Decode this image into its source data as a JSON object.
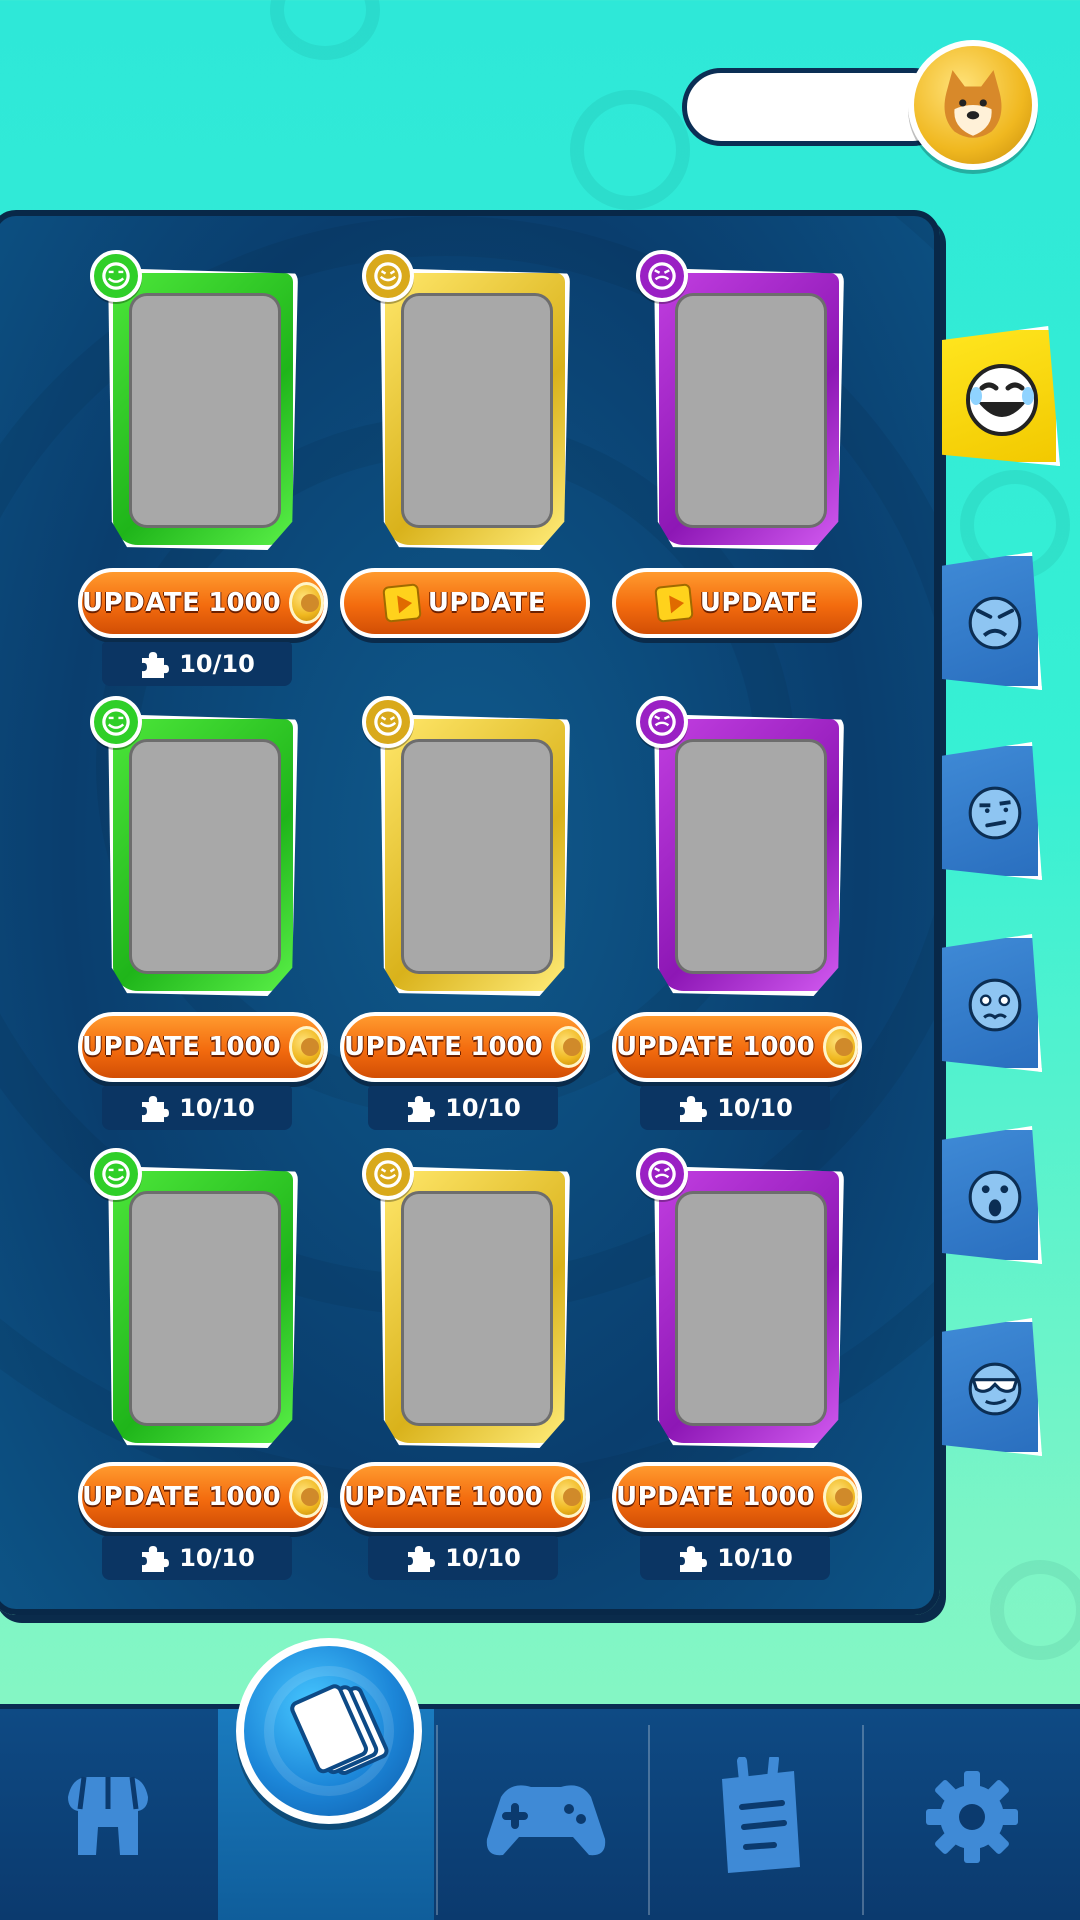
{
  "header": {
    "coin_balance": "",
    "coin_icon": "doge-coin-icon"
  },
  "cards": [
    {
      "color": "green",
      "button": {
        "type": "coin",
        "label": "UPDATE",
        "cost": "1000"
      },
      "progress": "10/10"
    },
    {
      "color": "yellow",
      "button": {
        "type": "video",
        "label": "UPDATE",
        "cost": ""
      },
      "progress": ""
    },
    {
      "color": "purple",
      "button": {
        "type": "video",
        "label": "UPDATE",
        "cost": ""
      },
      "progress": ""
    },
    {
      "color": "green",
      "button": {
        "type": "coin",
        "label": "UPDATE",
        "cost": "1000"
      },
      "progress": "10/10"
    },
    {
      "color": "yellow",
      "button": {
        "type": "coin",
        "label": "UPDATE",
        "cost": "1000"
      },
      "progress": "10/10"
    },
    {
      "color": "purple",
      "button": {
        "type": "coin",
        "label": "UPDATE",
        "cost": "1000"
      },
      "progress": "10/10"
    },
    {
      "color": "green",
      "button": {
        "type": "coin",
        "label": "UPDATE",
        "cost": "1000"
      },
      "progress": "10/10"
    },
    {
      "color": "yellow",
      "button": {
        "type": "coin",
        "label": "UPDATE",
        "cost": "1000"
      },
      "progress": "10/10"
    },
    {
      "color": "purple",
      "button": {
        "type": "coin",
        "label": "UPDATE",
        "cost": "1000"
      },
      "progress": "10/10"
    }
  ],
  "side_tabs": [
    {
      "icon": "laughing-face-icon",
      "active": true
    },
    {
      "icon": "angry-face-icon",
      "active": false
    },
    {
      "icon": "suspicious-face-icon",
      "active": false
    },
    {
      "icon": "crying-face-icon",
      "active": false
    },
    {
      "icon": "shocked-face-icon",
      "active": false
    },
    {
      "icon": "cool-face-icon",
      "active": false
    }
  ],
  "bottom_nav": [
    {
      "icon": "shop-icon",
      "active": false
    },
    {
      "icon": "cards-icon",
      "active": true
    },
    {
      "icon": "gamepad-icon",
      "active": false
    },
    {
      "icon": "clipboard-icon",
      "active": false
    },
    {
      "icon": "gear-icon",
      "active": false
    }
  ],
  "colors": {
    "green": "#2fcf28",
    "yellow": "#d9a91b",
    "purple": "#9a20c4",
    "button_orange": "#f36b0e",
    "panel_blue": "#0c4a7b"
  }
}
